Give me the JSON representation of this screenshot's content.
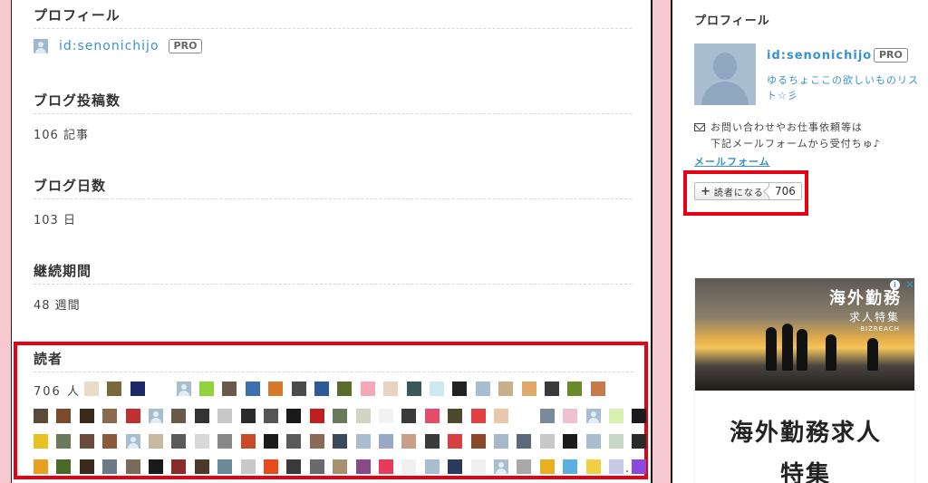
{
  "main": {
    "profile": {
      "title": "プロフィール",
      "user_id": "id:senonichijo",
      "pro": "PRO"
    },
    "post_count": {
      "title": "ブログ投稿数",
      "value": "106 記事"
    },
    "blog_days": {
      "title": "ブログ日数",
      "value": "103 日"
    },
    "period": {
      "title": "継続期間",
      "value": "48 週間"
    },
    "readers": {
      "title": "読者",
      "count_label": "706 人",
      "more": "..."
    }
  },
  "sidebar": {
    "title": "プロフィール",
    "user_id": "id:senonichijo",
    "pro": "PRO",
    "description": "ゆるちょここの欲しいものリスト☆彡",
    "mail_note_1": "お問い合わせやお仕事依頼等は",
    "mail_note_2": "下記メールフォームから受付ちゅ♪",
    "mail_link": "メールフォーム",
    "subscribe_label": "読者になる",
    "subscriber_count": "706"
  },
  "ad": {
    "headline": "海外勤務",
    "subline": "求人特集",
    "brand": "BIZREACH",
    "body_line1": "海外勤務求人",
    "body_line2": "特集",
    "info_icon": "i",
    "close_icon": "✕"
  },
  "reader_icons": {
    "row1": [
      "#e9dcc7",
      "#7a6a3a",
      "#1b2a66",
      "#ffffff",
      "def",
      "#8fd43a",
      "#6b5a4a",
      "#3a6fb0",
      "#d67a2a",
      "#4b4b4b",
      "#2a5b9a",
      "#5a6b2a",
      "#f7a8b8",
      "#e6d4c0",
      "#3a5a5a",
      "#cfe8f0",
      "#222222",
      "#a9bdd0",
      "#c8b08a",
      "#e0a86a",
      "#3a3a3a",
      "#6a8a2a",
      "#c97a4a"
    ],
    "row2": [
      "#5a4a3a",
      "#7a4a2a",
      "#3a2a1a",
      "#8a6a4a",
      "#c03030",
      "def",
      "#6a5a4a",
      "#333333",
      "#c8c8c8",
      "#2a2a2a",
      "#555555",
      "#1a1a1a",
      "#c02020",
      "#6a7a5a",
      "#d4d4c4",
      "#f2f2f2",
      "#3a3a3a",
      "#e84a6a",
      "#4a4a2a",
      "#e04040",
      "#e8c8a8",
      "#ffffff",
      "#7a8a9a",
      "#f0c0d0",
      "def",
      "#d8f0b0",
      "#1a1a1a"
    ],
    "row3": [
      "#e8c020",
      "#6a7a5a",
      "#6a4a3a",
      "#8a5a3a",
      "def",
      "#c8b8a0",
      "#5a5a5a",
      "#d8d8d8",
      "#888888",
      "#c84a2a",
      "#1a1a1a",
      "#5a5a5a",
      "#8a6a5a",
      "#3a4a5a",
      "#a9bdd0",
      "#9aa8c8",
      "#c8a088",
      "#3a3a3a",
      "#d84040",
      "#8a4a2a",
      "#a8b8c8",
      "#5a6a7a",
      "#c8c8c8",
      "#1a1a1a",
      "#a9bdd0",
      "#c8d8c8",
      "#2a2a2a"
    ],
    "row4": [
      "#e8a020",
      "#4a6a2a",
      "#3a2a1a",
      "#6a7a8a",
      "#7a6a5a",
      "#1a1a1a",
      "#8a2a2a",
      "#4a3a2a",
      "#6a8a9a",
      "#c8c8c8",
      "#e84a1a",
      "#3a3a3a",
      "#6a6a6a",
      "#a89070",
      "#8a4a8a",
      "#e83a5a",
      "#f0f0f0",
      "#a9bdd0",
      "#2a3a5a",
      "#f0f0f0",
      "def",
      "#a8a8a8",
      "#e8b020",
      "#5ab0e0",
      "#f0d040",
      "#c8c8e8",
      "#8a4ae0"
    ]
  }
}
